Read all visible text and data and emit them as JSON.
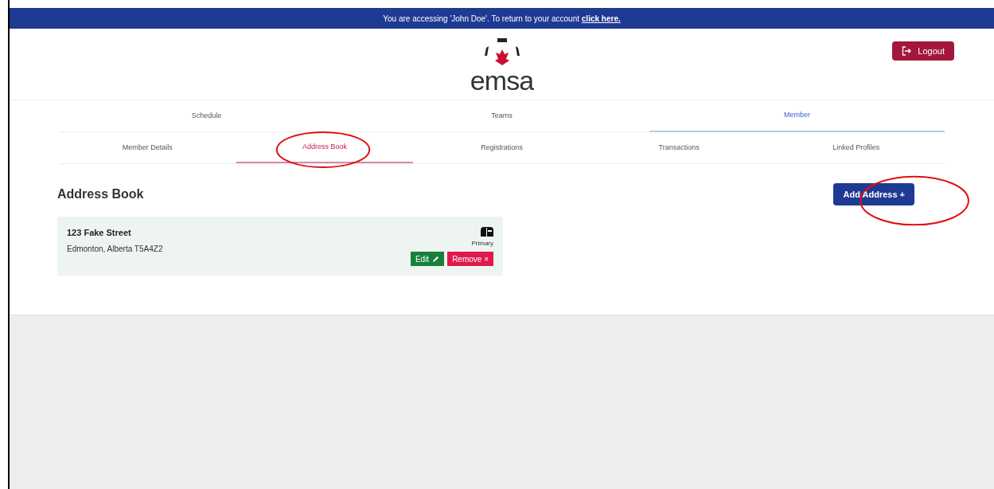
{
  "banner": {
    "text": "You are accessing 'John Doe'. To return to your account",
    "link": "click here."
  },
  "logo": {
    "text": "emsa"
  },
  "logout_button": {
    "label": "Logout"
  },
  "main_tabs": [
    {
      "label": "Schedule",
      "selected": false
    },
    {
      "label": "Teams",
      "selected": false
    },
    {
      "label": "Member",
      "selected": true
    }
  ],
  "sub_tabs": [
    {
      "label": "Member Details",
      "selected": false,
      "circled": false
    },
    {
      "label": "Address Book",
      "selected": true,
      "circled": true
    },
    {
      "label": "Registrations",
      "selected": false,
      "circled": false
    },
    {
      "label": "Transactions",
      "selected": false,
      "circled": false
    },
    {
      "label": "Linked Profiles",
      "selected": false,
      "circled": false
    }
  ],
  "section_title": "Address Book",
  "add_button": {
    "label": "Add Address +",
    "circled": true
  },
  "addresses": [
    {
      "line1": "123 Fake Street",
      "line2": "Edmonton, Alberta T5A4Z2",
      "badge": "Primary",
      "edit": "Edit",
      "remove": "Remove ×"
    }
  ]
}
